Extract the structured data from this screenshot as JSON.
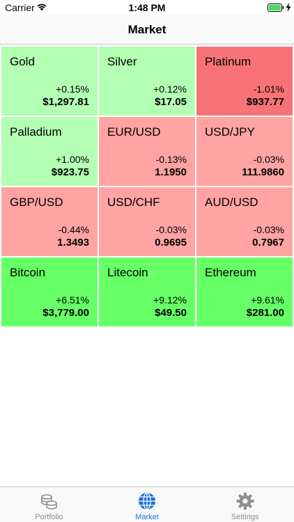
{
  "status": {
    "carrier": "Carrier",
    "time": "1:48 PM"
  },
  "nav": {
    "title": "Market"
  },
  "colors": {
    "up_light": "#b3ffb3",
    "up_strong": "#66ff66",
    "down_light": "#ffa3a3",
    "down_strong": "#f87377",
    "accent": "#1b6fd8"
  },
  "tiles": [
    {
      "name": "Gold",
      "change": "+0.15%",
      "price": "$1,297.81",
      "color": "#b3ffb3"
    },
    {
      "name": "Silver",
      "change": "+0.12%",
      "price": "$17.05",
      "color": "#b3ffb3"
    },
    {
      "name": "Platinum",
      "change": "-1.01%",
      "price": "$937.77",
      "color": "#f87377"
    },
    {
      "name": "Palladium",
      "change": "+1.00%",
      "price": "$923.75",
      "color": "#b3ffb3"
    },
    {
      "name": "EUR/USD",
      "change": "-0.13%",
      "price": "1.1950",
      "color": "#ffa3a3"
    },
    {
      "name": "USD/JPY",
      "change": "-0.03%",
      "price": "111.9860",
      "color": "#ffa3a3"
    },
    {
      "name": "GBP/USD",
      "change": "-0.44%",
      "price": "1.3493",
      "color": "#ffa3a3"
    },
    {
      "name": "USD/CHF",
      "change": "-0.03%",
      "price": "0.9695",
      "color": "#ffa3a3"
    },
    {
      "name": "AUD/USD",
      "change": "-0.03%",
      "price": "0.7967",
      "color": "#ffa3a3"
    },
    {
      "name": "Bitcoin",
      "change": "+6.51%",
      "price": "$3,779.00",
      "color": "#66ff66"
    },
    {
      "name": "Litecoin",
      "change": "+9.12%",
      "price": "$49.50",
      "color": "#66ff66"
    },
    {
      "name": "Ethereum",
      "change": "+9.61%",
      "price": "$281.00",
      "color": "#66ff66"
    }
  ],
  "tabs": [
    {
      "label": "Portfolio",
      "icon": "coins-icon",
      "active": false
    },
    {
      "label": "Market",
      "icon": "globe-icon",
      "active": true
    },
    {
      "label": "Settings",
      "icon": "gear-icon",
      "active": false
    }
  ]
}
